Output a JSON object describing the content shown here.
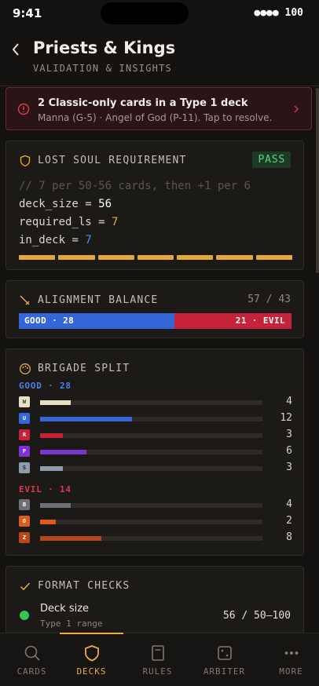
{
  "status": {
    "time": "9:41",
    "signal": "●●●● 100"
  },
  "header": {
    "title": "Priests & Kings",
    "subtitle": "VALIDATION & INSIGHTS"
  },
  "alert": {
    "title": "2 Classic-only cards in a Type 1 deck",
    "detail": "Manna (G-5) · Angel of God (P-11). Tap to resolve."
  },
  "lost_soul": {
    "label": "LOST SOUL REQUIREMENT",
    "badge": "PASS",
    "comment": "// 7 per 50-56 cards, then +1 per 6",
    "deck_size_key": "deck_size",
    "deck_size_val": "56",
    "required_key": "required_ls",
    "required_val": "7",
    "in_deck_key": "in_deck",
    "in_deck_val": "7",
    "segments": 7
  },
  "alignment": {
    "label": "ALIGNMENT BALANCE",
    "ratio": "57 / 43",
    "good": 57,
    "evil": 43,
    "good_label": "GOOD · 28",
    "evil_label": "21 · EVIL"
  },
  "brigade": {
    "label": "BRIGADE SPLIT",
    "good_label": "GOOD · 28",
    "evil_label": "EVIL · 14",
    "good_rows": [
      {
        "code": "W",
        "count": "4",
        "value": 4,
        "color": "#e8dfc4",
        "text": "#333"
      },
      {
        "code": "U",
        "count": "12",
        "value": 12,
        "color": "#3466d8",
        "text": "#fff"
      },
      {
        "code": "R",
        "count": "3",
        "value": 3,
        "color": "#c62239",
        "text": "#fff"
      },
      {
        "code": "P",
        "count": "6",
        "value": 6,
        "color": "#7b33d6",
        "text": "#fff"
      },
      {
        "code": "S",
        "count": "3",
        "value": 3,
        "color": "#8f9aaa",
        "text": "#222"
      }
    ],
    "evil_rows": [
      {
        "code": "B",
        "count": "4",
        "value": 4,
        "color": "#6d6f75",
        "text": "#fff"
      },
      {
        "code": "O",
        "count": "2",
        "value": 2,
        "color": "#e05a1c",
        "text": "#fff"
      },
      {
        "code": "Z",
        "count": "8",
        "value": 8,
        "color": "#b5451a",
        "text": "#fff"
      }
    ],
    "max": 29
  },
  "format": {
    "label": "FORMAT CHECKS",
    "item_title": "Deck size",
    "item_sub": "Type 1 range",
    "item_val": "56 / 50–100"
  },
  "tabs": [
    {
      "label": "CARDS",
      "icon": "search-icon",
      "active": false
    },
    {
      "label": "DECKS",
      "icon": "shield-icon",
      "active": true
    },
    {
      "label": "RULES",
      "icon": "book-icon",
      "active": false
    },
    {
      "label": "ARBITER",
      "icon": "dice-icon",
      "active": false
    },
    {
      "label": "MORE",
      "icon": "more-icon",
      "active": false
    }
  ],
  "colors": {
    "accent": "#e6ad3a",
    "good": "#3466d8",
    "evil": "#c62239",
    "pass": "#5fd07d"
  }
}
